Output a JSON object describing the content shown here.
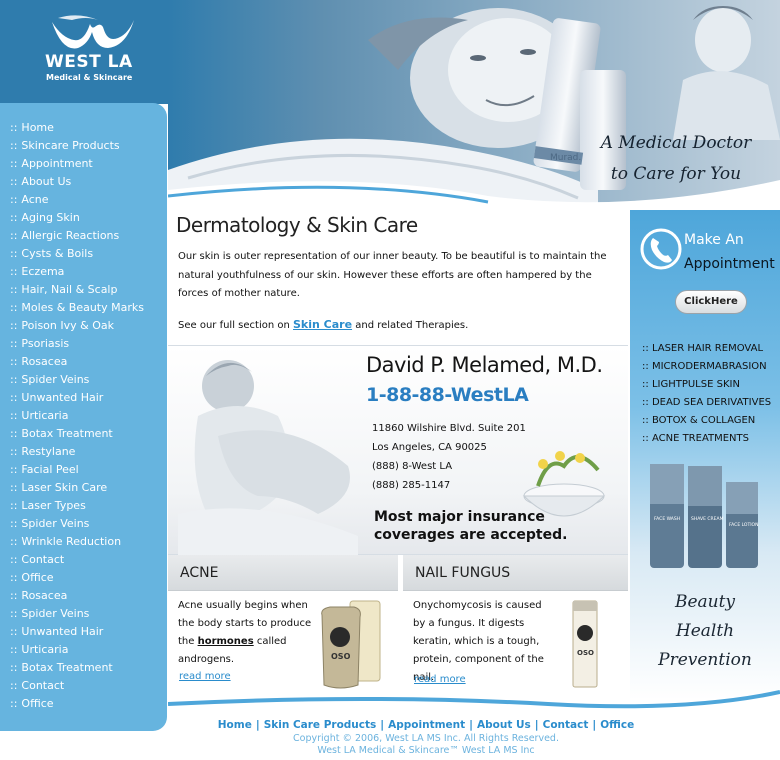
{
  "brand": {
    "name": "WEST LA",
    "subtitle": "Medical & Skincare",
    "logo_color": "#ffffff",
    "brand_color": "#2f7cad"
  },
  "hero": {
    "tagline_line1": "A Medical Doctor",
    "tagline_line2": "to Care for You",
    "product_label": "Murad."
  },
  "nav": {
    "bullet": "::",
    "items": [
      "Home",
      "Skincare Products",
      "Appointment",
      "About Us",
      "Acne",
      "Aging Skin",
      "Allergic Reactions",
      "Cysts & Boils",
      "Eczema",
      "Hair, Nail & Scalp",
      "Moles & Beauty Marks",
      "Poison Ivy & Oak",
      "Psoriasis",
      "Rosacea",
      "Spider Veins",
      "Unwanted Hair",
      "Urticaria",
      "Botax Treatment",
      "Restylane",
      "Facial Peel",
      "Laser Skin Care",
      "Laser Types",
      "Spider Veins",
      "Wrinkle Reduction",
      "Contact",
      "Office",
      "Rosacea",
      "Spider Veins",
      "Unwanted Hair",
      "Urticaria",
      "Botax Treatment",
      "Contact",
      "Office"
    ],
    "background_color": "#66b4df"
  },
  "intro": {
    "title": "Dermatology & Skin Care",
    "body": "Our skin is outer representation of our inner beauty. To be beautiful is to maintain the natural youthfulness of our skin. However these efforts are often hampered by the forces of mother nature.",
    "see_prefix": "See our full section on ",
    "see_link": "Skin Care",
    "see_suffix": " and related Therapies."
  },
  "doctor": {
    "name": "David P. Melamed, M.D.",
    "phone": "1-88-88-WestLA",
    "address_line1": "11860 Wilshire Blvd. Suite 201",
    "address_line2": "Los Angeles, CA 90025",
    "phone_line1": "(888) 8-West LA",
    "phone_line2": "(888) 285-1147",
    "insurance_line1": "Most major insurance",
    "insurance_line2": "coverages are accepted."
  },
  "features": {
    "acne": {
      "title": "ACNE",
      "text_before": "Acne usually begins when the body starts to produce the ",
      "text_link": "hormones",
      "text_after": " called androgens.",
      "more": "read more",
      "product_label": "OSO"
    },
    "fungus": {
      "title": "NAIL FUNGUS",
      "text": "Onychomycosis is caused by a fungus. It digests keratin, which is a tough, protein, component of the nail.",
      "more": "read more",
      "product_label": "OSO"
    }
  },
  "appointment": {
    "line1": "Make An",
    "line2": "Appointment",
    "button": "ClickHere",
    "phone_icon": "phone-icon"
  },
  "services": {
    "bullet": "::",
    "items": [
      "LASER HAIR REMOVAL",
      "MICRODERMABRASION",
      "LIGHTPULSE SKIN",
      "DEAD SEA DERIVATIVES",
      "BOTOX & COLLAGEN",
      "ACNE TREATMENTS"
    ]
  },
  "products": {
    "label1": "FACE WASH",
    "label2": "SHAVE CREAM",
    "label3": "FACE LOTION"
  },
  "slogan": {
    "line1": "Beauty",
    "line2": "Health",
    "line3": "Prevention"
  },
  "footer": {
    "links": [
      "Home",
      "Skin Care Products",
      "Appointment",
      "About Us",
      "Contact",
      "Office"
    ],
    "separator": "|",
    "copyright": "Copyright © 2006, West LA MS Inc. All Rights Reserved.",
    "trademark": "West LA Medical & Skincare™ West LA MS Inc",
    "link_color": "#2a8ccc"
  }
}
